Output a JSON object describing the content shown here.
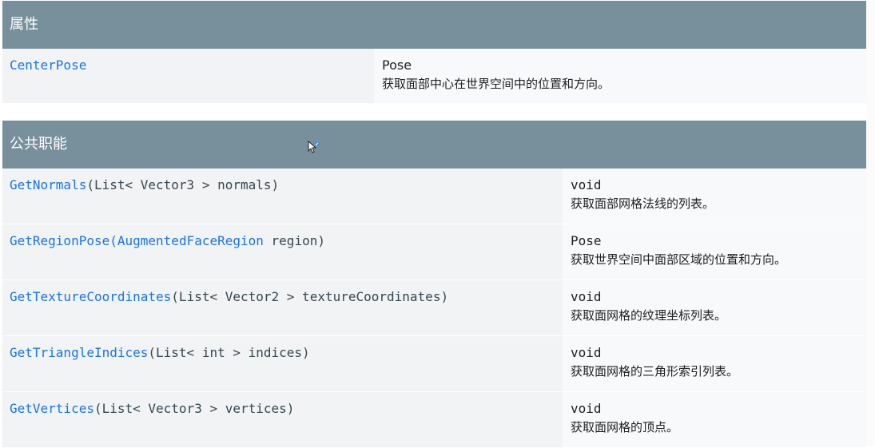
{
  "properties": {
    "heading": "属性",
    "rows": [
      {
        "name": "CenterPose",
        "type": "Pose",
        "desc": "获取面部中心在世界空间中的位置和方向。"
      }
    ]
  },
  "functions": {
    "heading": "公共职能",
    "rows": [
      {
        "name": "GetNormals",
        "sig_before": "(List< Vector3 > normals)",
        "return_type": "void",
        "desc": "获取面部网格法线的列表。"
      },
      {
        "name": "GetRegionPose",
        "sig_open": "(",
        "param_link": "AugmentedFaceRegion",
        "sig_after": " region)",
        "return_type": "Pose",
        "desc": "获取世界空间中面部区域的位置和方向。"
      },
      {
        "name": "GetTextureCoordinates",
        "sig_before": "(List< Vector2 > textureCoordinates)",
        "return_type": "void",
        "desc": "获取面网格的纹理坐标列表。"
      },
      {
        "name": "GetTriangleIndices",
        "sig_before": "(List< int > indices)",
        "return_type": "void",
        "desc": "获取面网格的三角形索引列表。"
      },
      {
        "name": "GetVertices",
        "sig_before": "(List< Vector3 > vertices)",
        "return_type": "void",
        "desc": "获取面网格的顶点。"
      }
    ]
  },
  "colors": {
    "header_bg": "#78909c",
    "link": "#1a73e8",
    "cell_left_bg": "#f1f3f4",
    "cell_right_bg": "#f8f9fa"
  },
  "icons": {
    "cursor": "mouse-pointer-icon"
  }
}
